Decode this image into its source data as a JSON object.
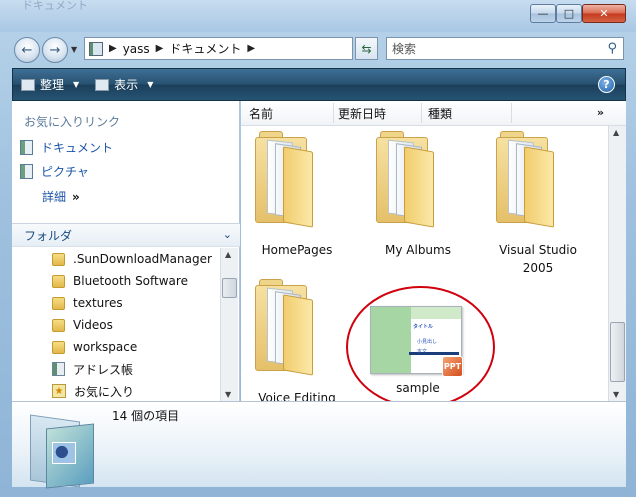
{
  "window": {
    "title_ghost": "ドキュメント"
  },
  "nav": {
    "breadcrumb": [
      "yass",
      "ドキュメント"
    ],
    "search_placeholder": "検索"
  },
  "toolbar": {
    "organize_label": "整理",
    "views_label": "表示",
    "help_symbol": "?"
  },
  "sidebar": {
    "favorites_title": "お気に入りリンク",
    "favorites": [
      {
        "label": "ドキュメント",
        "icon": "documents-icon"
      },
      {
        "label": "ピクチャ",
        "icon": "pictures-icon"
      }
    ],
    "more_label": "詳細",
    "more_symbol": "»",
    "folders_title": "フォルダ",
    "tree": [
      {
        "label": ".SunDownloadManager",
        "icon": "folder-icon"
      },
      {
        "label": "Bluetooth Software",
        "icon": "folder-icon"
      },
      {
        "label": "textures",
        "icon": "folder-icon"
      },
      {
        "label": "Videos",
        "icon": "folder-icon"
      },
      {
        "label": "workspace",
        "icon": "folder-icon"
      },
      {
        "label": "アドレス帳",
        "icon": "address-book-icon"
      },
      {
        "label": "お気に入り",
        "icon": "favorites-icon"
      }
    ]
  },
  "columns": [
    "名前",
    "更新日時",
    "種類"
  ],
  "columns_more": "»",
  "files": [
    {
      "name": "HomePages",
      "type": "folder"
    },
    {
      "name": "My Albums",
      "type": "folder"
    },
    {
      "name": "Visual Studio 2005",
      "type": "folder"
    },
    {
      "name": "Voice Editing",
      "type": "folder"
    },
    {
      "name": "sample",
      "type": "presentation"
    }
  ],
  "sample_thumb": {
    "line1": "タイトル",
    "line2": "小見出し",
    "line3": "本文",
    "badge": "PPT"
  },
  "details": {
    "item_count": "14 個の項目"
  },
  "colors": {
    "toolbar": "#26506f",
    "link": "#1a55a8",
    "annotation_circle": "#d0000d"
  }
}
